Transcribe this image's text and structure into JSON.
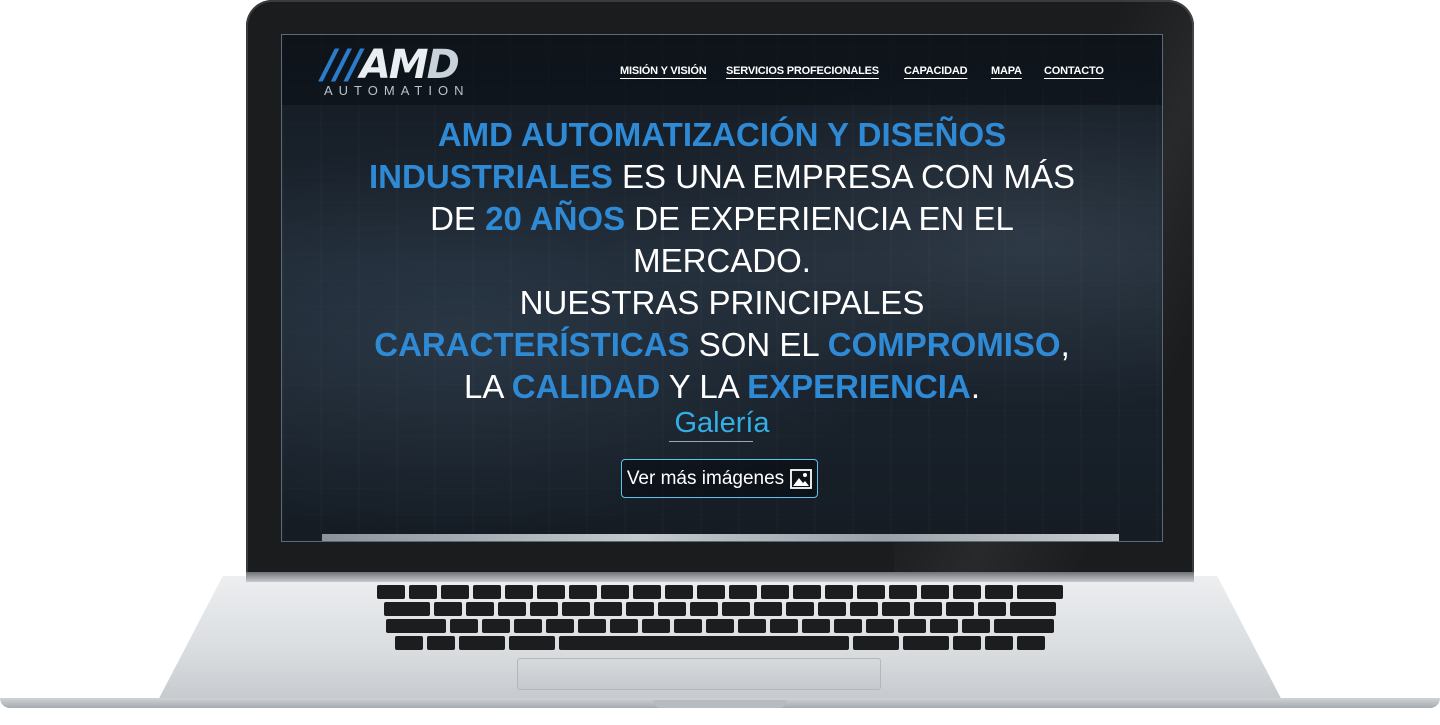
{
  "logo": {
    "slashes": "///",
    "mark_am": "AM",
    "mark_d": "D",
    "subtitle": "AUTOMATION"
  },
  "nav": [
    {
      "label": "MISIÓN Y VISIÓN"
    },
    {
      "label": "SERVICIOS PROFECIONALES"
    },
    {
      "label": "CAPACIDAD"
    },
    {
      "label": "MAPA"
    },
    {
      "label": "CONTACTO"
    }
  ],
  "hero": {
    "l1_a": "AMD AUTOMATIZACIÓN Y DISEÑOS",
    "l2_a": "INDUSTRIALES",
    "l2_b": " ES UNA EMPRESA CON MÁS",
    "l3_a": "DE ",
    "l3_b": "20 AÑOS",
    "l3_c": " DE EXPERIENCIA EN EL",
    "l4_a": "MERCADO.",
    "l5_a": "NUESTRAS PRINCIPALES",
    "l6_a": "CARACTERÍSTICAS",
    "l6_b": " SON EL ",
    "l6_c": "COMPROMISO",
    "l6_d": ",",
    "l7_a": "LA ",
    "l7_b": "CALIDAD",
    "l7_c": " Y LA ",
    "l7_d": "EXPERIENCIA",
    "l7_e": "."
  },
  "gallery": {
    "title": "Galería",
    "button_label": "Ver más imágenes",
    "button_icon": "image-icon"
  },
  "colors": {
    "accent_blue": "#2f8ad6",
    "gallery_cyan": "#32b0e6"
  }
}
